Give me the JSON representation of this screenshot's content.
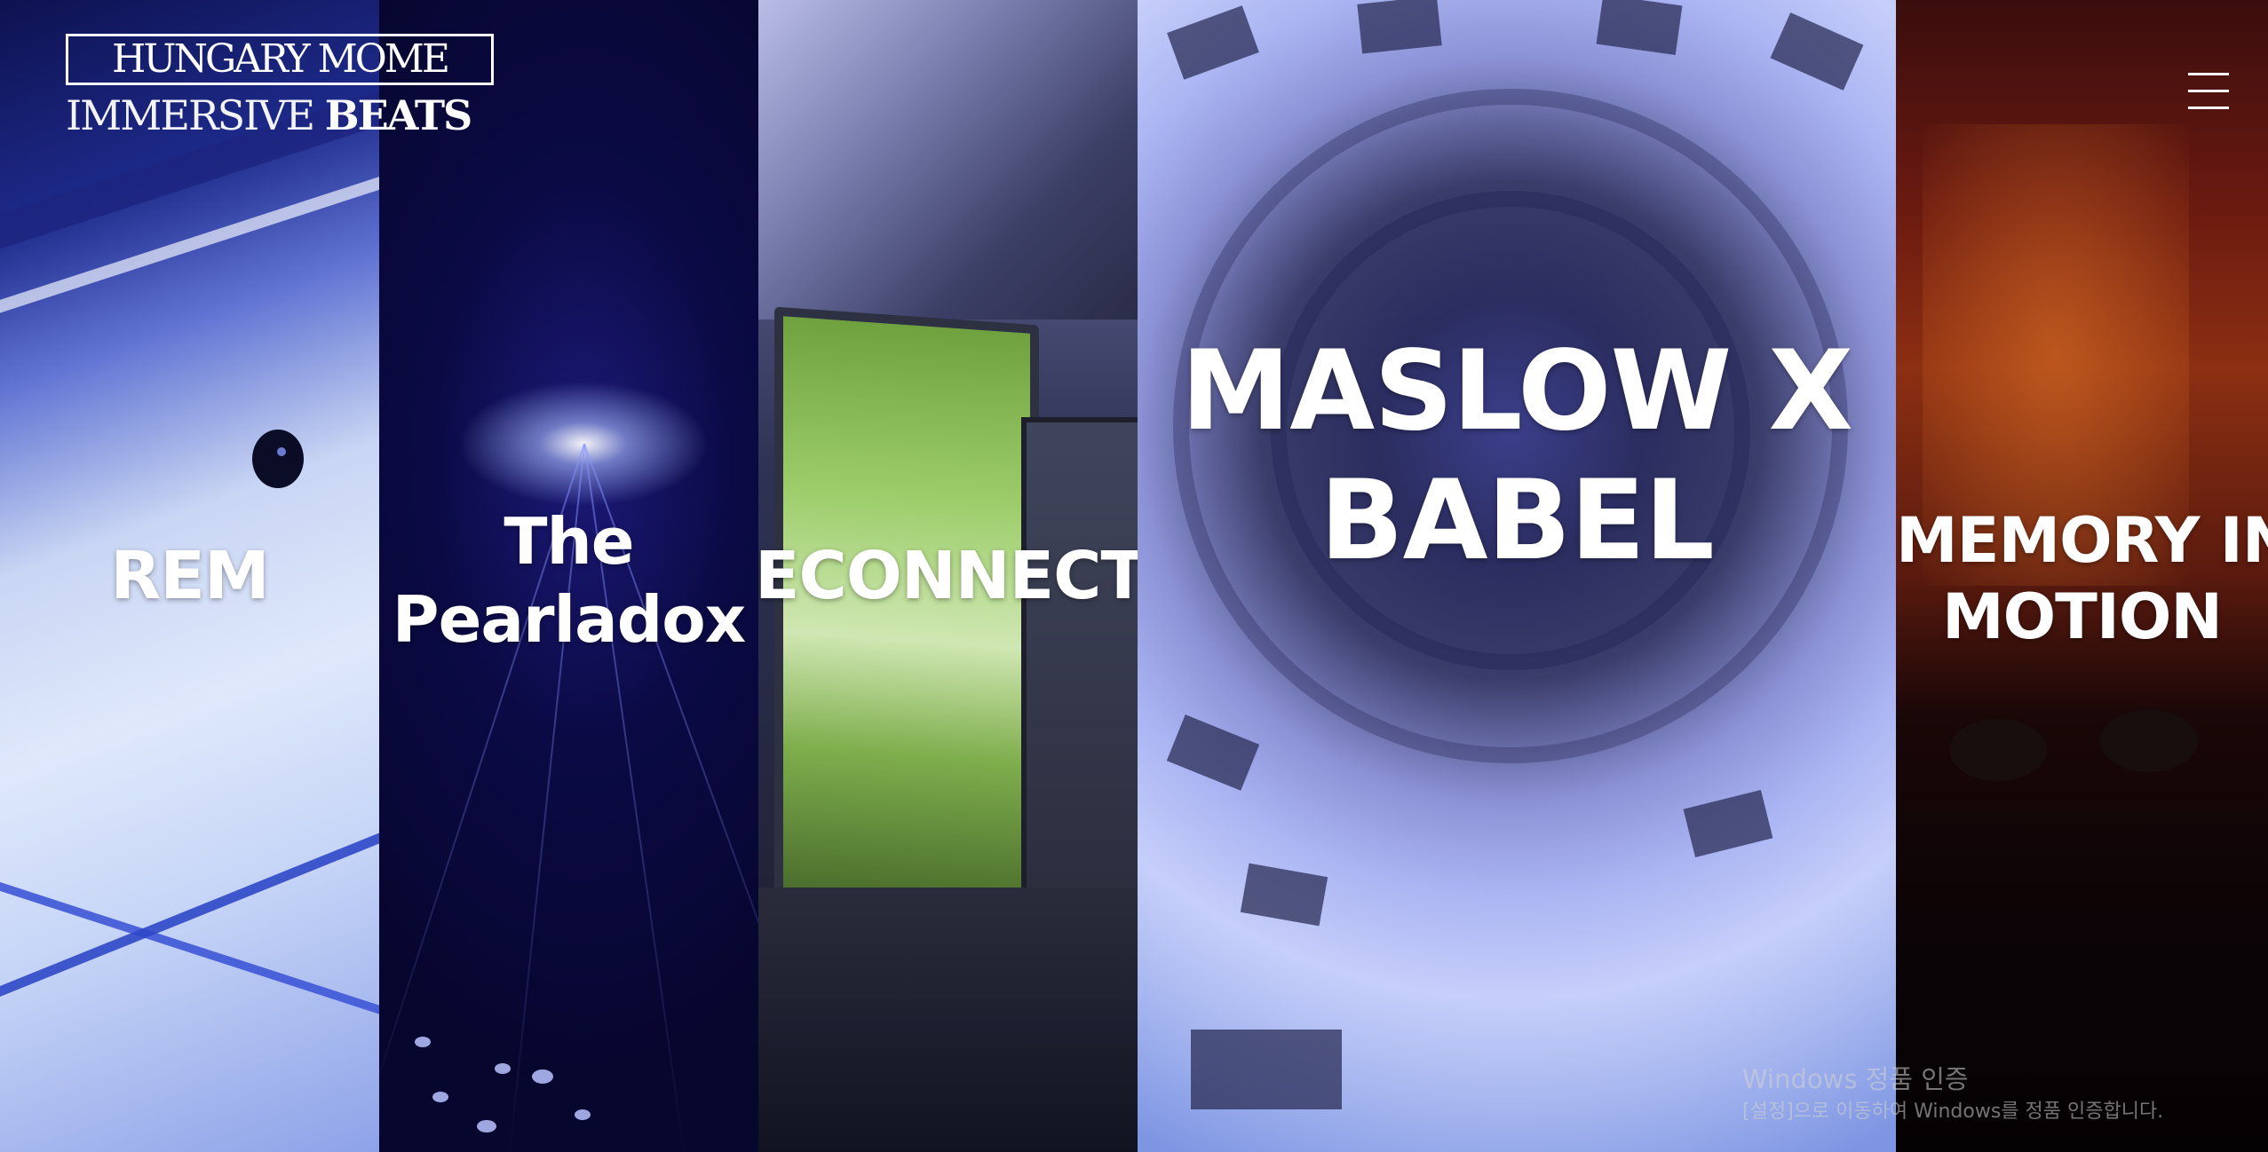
{
  "header": {
    "logo": {
      "line1": "HUNGARY MOME",
      "line2_light": "IMMERSIVE ",
      "line2_bold": "BEATS"
    },
    "menu_icon": "hamburger-menu-icon"
  },
  "panels": [
    {
      "title_lines": [
        "REM"
      ]
    },
    {
      "title_lines": [
        "The",
        "Pearladox"
      ]
    },
    {
      "title_lines": [
        "RECONNECTION"
      ]
    },
    {
      "title_lines": [
        "MASLOW X",
        "BABEL"
      ]
    },
    {
      "title_lines": [
        "MEMORY IN",
        "MOTION"
      ]
    }
  ],
  "watermark": {
    "title": "Windows 정품 인증",
    "subtitle": "[설정]으로 이동하여 Windows를 정품 인증합니다."
  },
  "colors": {
    "text": "#ffffff",
    "panel_rem": "#c9d6f4",
    "panel_pearladox": "#0b0a45",
    "panel_reconnection": "#2f3354",
    "panel_maslow": "#8c92d6",
    "panel_memory": "#3a0d0d"
  }
}
